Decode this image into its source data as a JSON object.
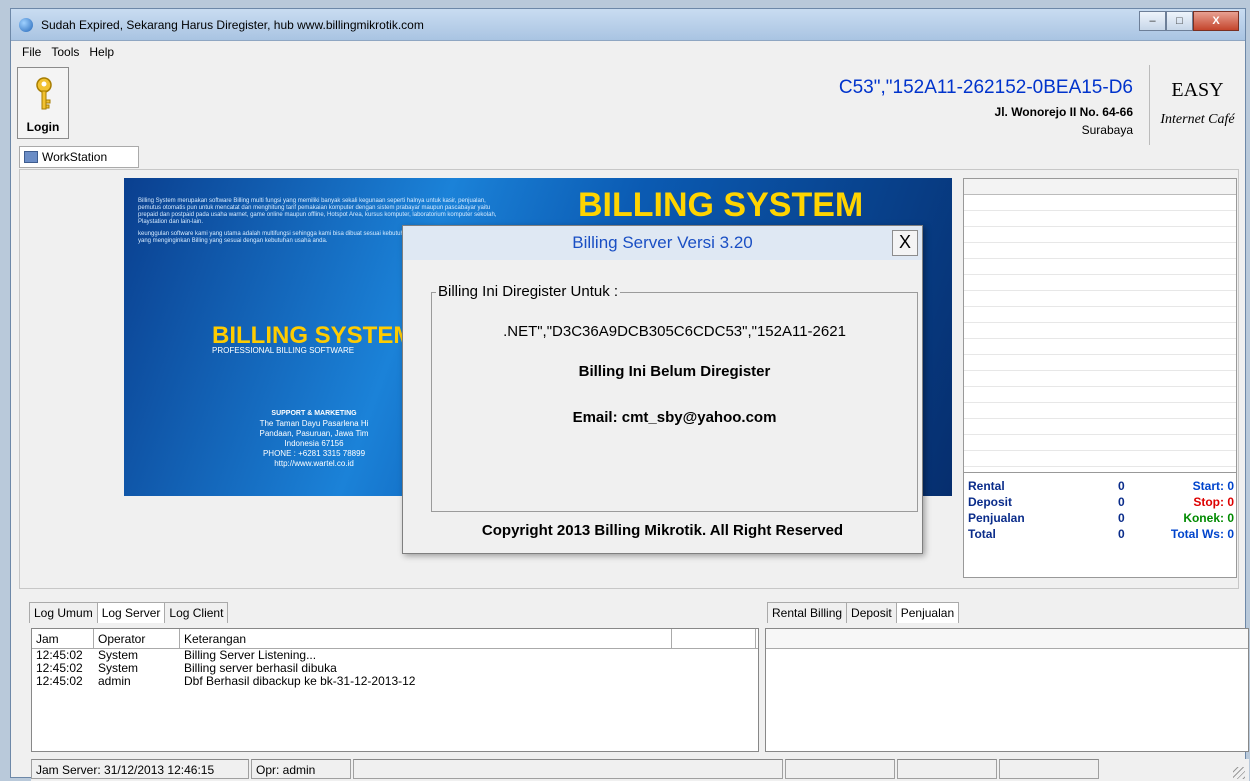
{
  "window": {
    "title": "Sudah Expired, Sekarang Harus Diregister, hub www.billingmikrotik.com",
    "minimize": "–",
    "maximize": "□",
    "close": "X"
  },
  "menu": [
    "File",
    "Tools",
    "Help"
  ],
  "toolbar": {
    "login_label": "Login"
  },
  "header": {
    "code": "C53\",\"152A11-262152-0BEA15-D6",
    "address": "Jl. Wonorejo II No. 64-66",
    "city": "Surabaya",
    "logo_top": "EASY",
    "logo_bottom": "Internet Café"
  },
  "workstation_tab": "WorkStation",
  "banner": {
    "title": "BILLING SYSTEM",
    "logo": "BILLING SYSTEM",
    "subtitle": "PROFESSIONAL BILLING SOFTWARE",
    "intro": "Billing System merupakan software Billing multi fungsi yang memiliki banyak sekali kegunaan seperti halnya untuk kasir, penjualan, pemutus otomatis pun untuk mencatat dan menghitung tarif pemakaian komputer dengan sistem prabayar maupun pascabayar yaitu prepaid dan postpaid pada usaha warnet, game online maupun offline, Hotspot Area, kursus komputer, laboratorium komputer sekolah, Playstation dan lain-lain.",
    "intro2": "keunggulan software kami yang utama adalah multifungsi sehingga kami bisa dibuat sesuai kebutuhan anda, jadi cocok bagi anda yang menginginkan Billing yang sesuai dengan kebutuhan usaha anda.",
    "support_title": "SUPPORT & MARKETING",
    "support_lines": [
      "The Taman Dayu Pasarlena Hi",
      "Pandaan, Pasuruan, Jawa Tim",
      "Indonesia 67156",
      "PHONE : +6281 3315 78899",
      "http://www.wartel.co.id"
    ]
  },
  "stats": {
    "rental_label": "Rental",
    "rental_value": "0",
    "start_label": "Start: 0",
    "deposit_label": "Deposit",
    "deposit_value": "0",
    "stop_label": "Stop: 0",
    "penjualan_label": "Penjualan",
    "penjualan_value": "0",
    "konek_label": "Konek: 0",
    "total_label": "Total",
    "total_value": "0",
    "total_ws_label": "Total Ws: 0"
  },
  "dialog": {
    "title": "Billing Server Versi 3.20",
    "close": "X",
    "group_legend": "Billing Ini Diregister Untuk :",
    "reg_code": ".NET\",\"D3C36A9DCB305C6CDC53\",\"152A11-2621",
    "status": "Billing Ini Belum Diregister",
    "email": "Email: cmt_sby@yahoo.com",
    "copyright": "Copyright 2013 Billing Mikrotik. All Right Reserved"
  },
  "log_tabs": [
    "Log Umum",
    "Log Server",
    "Log Client"
  ],
  "right_tabs": [
    "Rental Billing",
    "Deposit",
    "Penjualan"
  ],
  "log_columns": [
    "Jam",
    "Operator",
    "Keterangan",
    ""
  ],
  "log_rows": [
    {
      "jam": "12:45:02",
      "operator": "System",
      "keterangan": "Billing Server Listening..."
    },
    {
      "jam": "12:45:02",
      "operator": "System",
      "keterangan": "Billing server berhasil dibuka"
    },
    {
      "jam": "12:45:02",
      "operator": "admin",
      "keterangan": "Dbf Berhasil dibackup ke bk-31-12-2013-12"
    }
  ],
  "statusbar": {
    "server_time": "Jam Server: 31/12/2013 12:46:15",
    "operator": "Opr: admin"
  }
}
